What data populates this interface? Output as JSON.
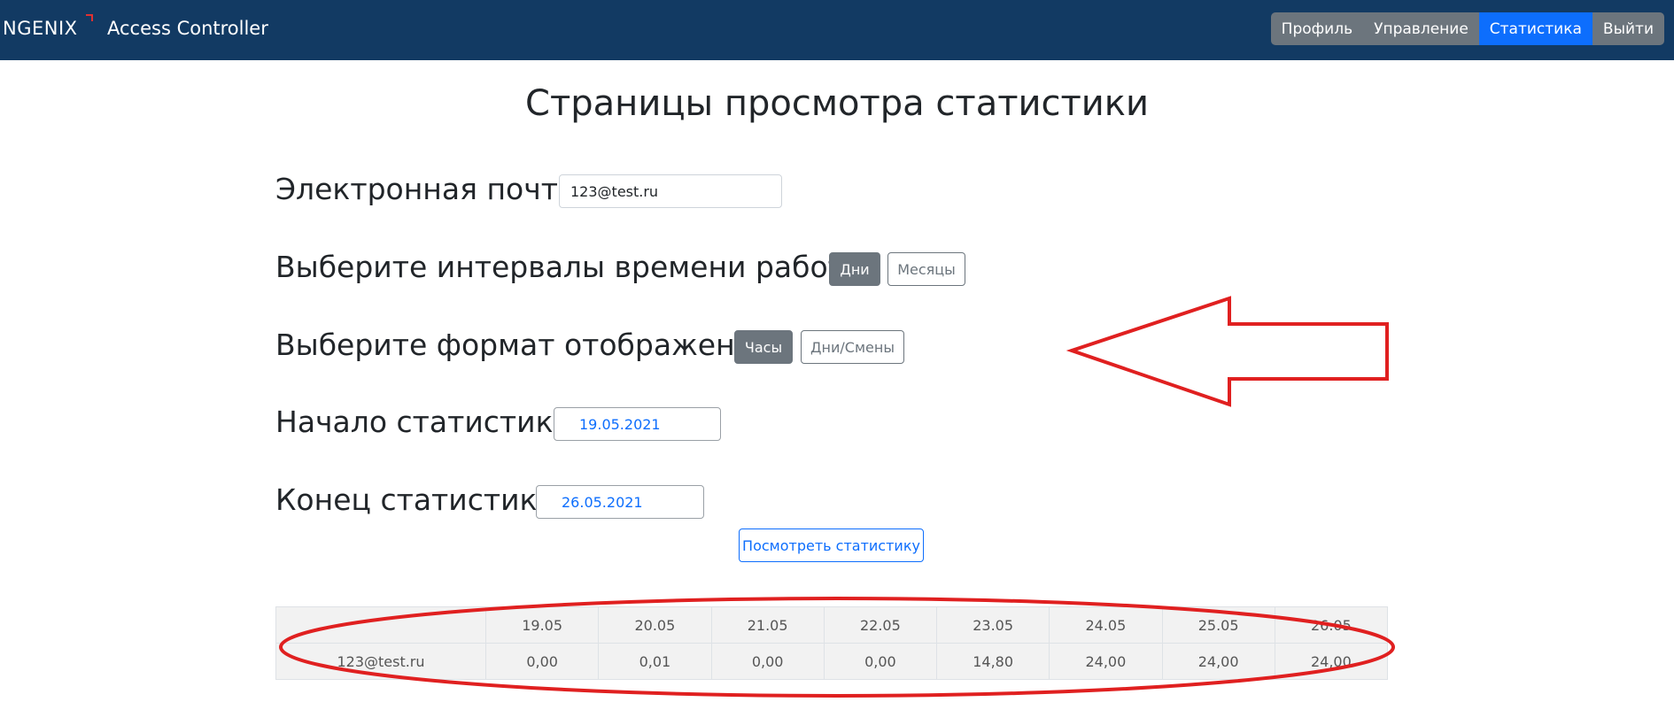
{
  "navbar": {
    "brand": "NGENIX",
    "title": "Access Controller",
    "items": [
      {
        "label": "Профиль",
        "active": false
      },
      {
        "label": "Управление",
        "active": false
      },
      {
        "label": "Статистика",
        "active": true
      },
      {
        "label": "Выйти",
        "active": false
      }
    ]
  },
  "page_title": "Страницы просмотра статистики",
  "email": {
    "label": "Электронная почта",
    "value": "123@test.ru"
  },
  "interval": {
    "label": "Выберите интервалы времени работы",
    "options": [
      {
        "label": "Дни",
        "selected": true
      },
      {
        "label": "Месяцы",
        "selected": false
      }
    ]
  },
  "format": {
    "label": "Выберите формат отображения",
    "options": [
      {
        "label": "Часы",
        "selected": true
      },
      {
        "label": "Дни/Смены",
        "selected": false
      }
    ]
  },
  "start": {
    "label": "Начало статистики",
    "value": "19.05.2021"
  },
  "end": {
    "label": "Конец статистики",
    "value": "26.05.2021"
  },
  "view_button": "Посмотреть статистику",
  "table": {
    "headers": [
      "",
      "19.05",
      "20.05",
      "21.05",
      "22.05",
      "23.05",
      "24.05",
      "25.05",
      "26.05"
    ],
    "rows": [
      [
        "123@test.ru",
        "0,00",
        "0,01",
        "0,00",
        "0,00",
        "14,80",
        "24,00",
        "24,00",
        "24,00"
      ]
    ]
  },
  "colors": {
    "navbar": "#123a63",
    "accent": "#0d6efd",
    "annotation": "#e02020"
  }
}
